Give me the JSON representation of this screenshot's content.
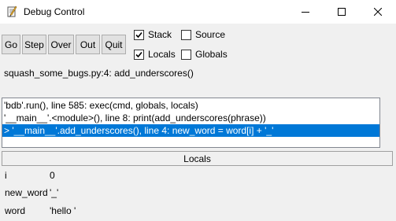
{
  "window": {
    "title": "Debug Control"
  },
  "toolbar": {
    "buttons": [
      "Go",
      "Step",
      "Over",
      "Out",
      "Quit"
    ]
  },
  "options": {
    "stack": {
      "label": "Stack",
      "checked": true
    },
    "source": {
      "label": "Source",
      "checked": false
    },
    "locals": {
      "label": "Locals",
      "checked": true
    },
    "globals": {
      "label": "Globals",
      "checked": false
    }
  },
  "status": "squash_some_bugs.py:4: add_underscores()",
  "stack": [
    "'bdb'.run(), line 585: exec(cmd, globals, locals)",
    "'__main__'.<module>(), line 8: print(add_underscores(phrase))",
    "> '__main__'.add_underscores(), line 4: new_word = word[i] + '_'"
  ],
  "selected_stack_index": 2,
  "locals_header": "Locals",
  "locals": [
    {
      "name": "i",
      "value": "0"
    },
    {
      "name": "new_word",
      "value": "'_'"
    },
    {
      "name": "word",
      "value": "'hello '"
    }
  ],
  "colors": {
    "selection": "#0078d7",
    "client_bg": "#f0f0f0"
  }
}
